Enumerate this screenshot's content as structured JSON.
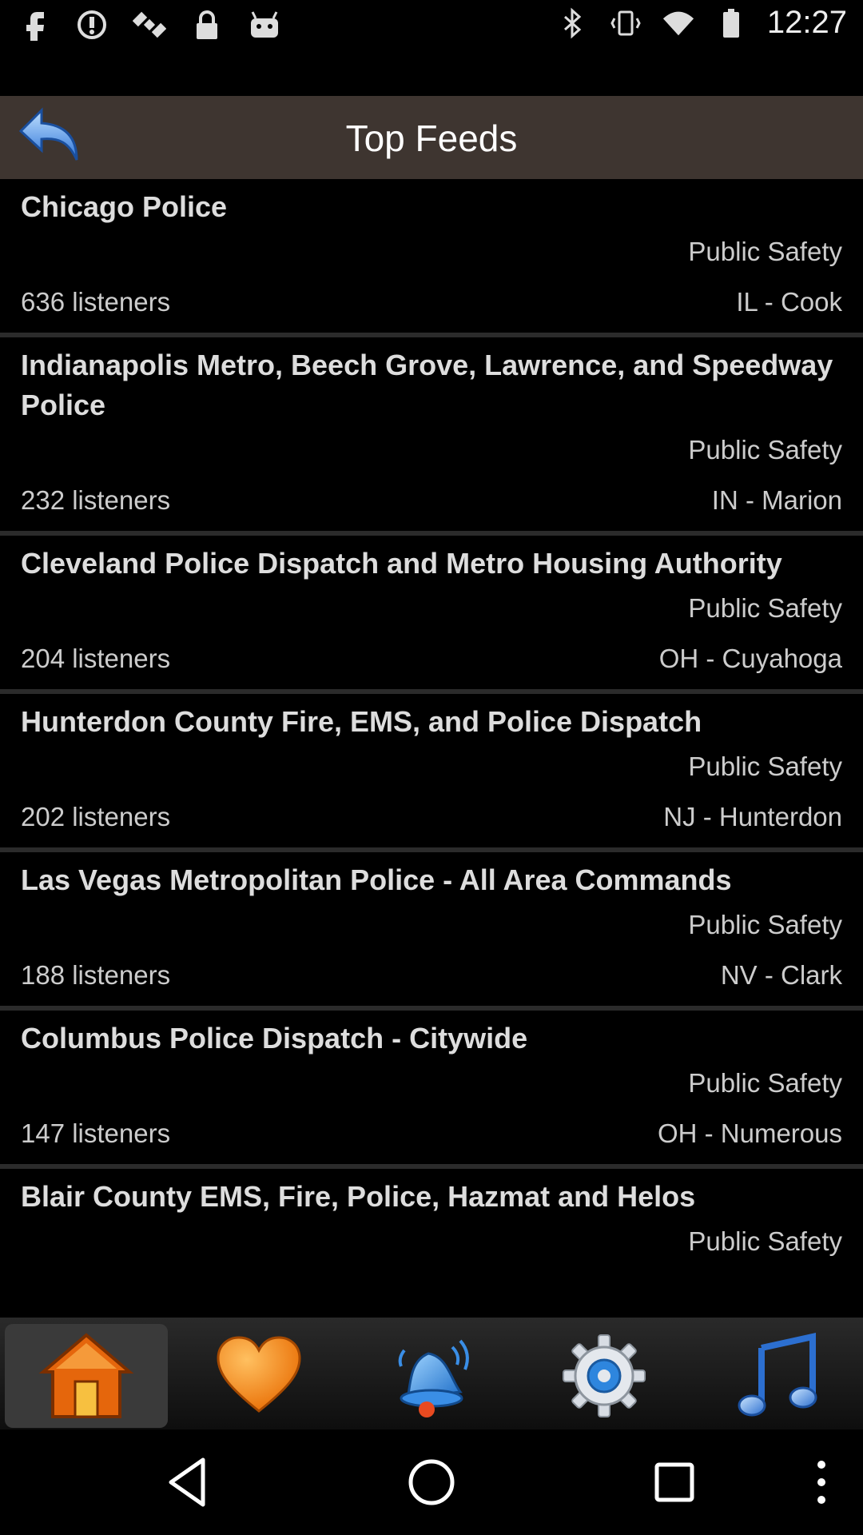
{
  "status_bar": {
    "time": "12:27",
    "left_icons": [
      "facebook-icon",
      "sync-icon",
      "satellite-icon",
      "lock-icon",
      "android-icon"
    ],
    "right_icons": [
      "bluetooth-icon",
      "vibrate-icon",
      "wifi-icon",
      "battery-icon"
    ]
  },
  "header": {
    "title": "Top Feeds",
    "back_icon": "back-arrow-icon"
  },
  "feeds": [
    {
      "name": "Chicago Police",
      "category": "Public Safety",
      "listeners": "636 listeners",
      "location": "IL - Cook"
    },
    {
      "name": "Indianapolis Metro, Beech Grove, Lawrence, and Speedway Police",
      "category": "Public Safety",
      "listeners": "232 listeners",
      "location": "IN - Marion"
    },
    {
      "name": "Cleveland Police Dispatch and Metro Housing Authority",
      "category": "Public Safety",
      "listeners": "204 listeners",
      "location": "OH - Cuyahoga"
    },
    {
      "name": "Hunterdon County Fire, EMS, and Police Dispatch",
      "category": "Public Safety",
      "listeners": "202 listeners",
      "location": "NJ - Hunterdon"
    },
    {
      "name": "Las Vegas Metropolitan Police - All Area Commands",
      "category": "Public Safety",
      "listeners": "188 listeners",
      "location": "NV - Clark"
    },
    {
      "name": "Columbus Police Dispatch - Citywide",
      "category": "Public Safety",
      "listeners": "147 listeners",
      "location": "OH - Numerous"
    },
    {
      "name": "Blair County EMS, Fire, Police, Hazmat and Helos",
      "category": "Public Safety",
      "listeners": "",
      "location": ""
    }
  ],
  "bottom_tabs": [
    {
      "icon": "home-icon",
      "active": true
    },
    {
      "icon": "heart-icon",
      "active": false
    },
    {
      "icon": "bell-icon",
      "active": false
    },
    {
      "icon": "settings-gear-icon",
      "active": false
    },
    {
      "icon": "music-note-icon",
      "active": false
    }
  ],
  "nav": [
    "back-triangle-icon",
    "home-circle-icon",
    "recents-square-icon",
    "more-dots-icon"
  ],
  "colors": {
    "titlebar": "#3e3530",
    "home_orange": "#f07a10",
    "heart": "#f58a18",
    "bell_blue": "#2a8be0"
  }
}
